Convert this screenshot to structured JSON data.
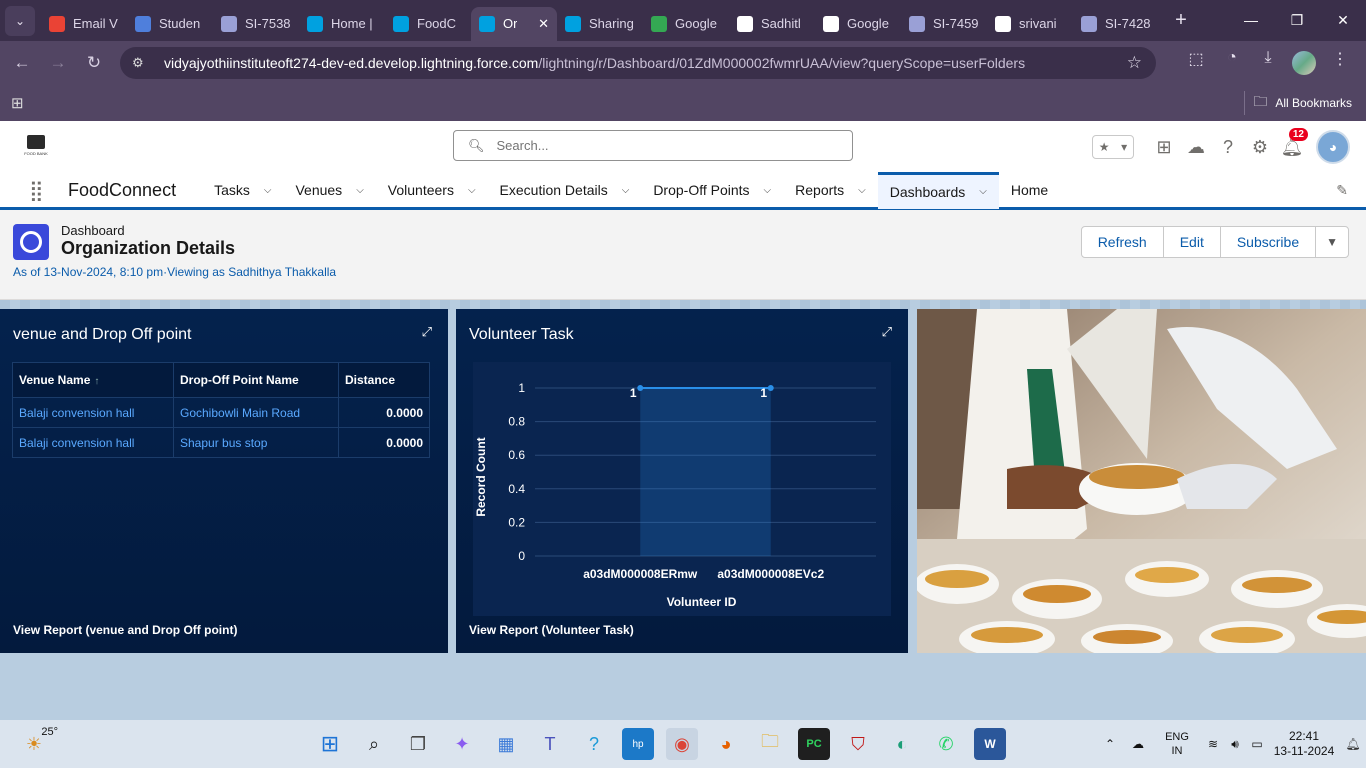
{
  "browser": {
    "tabs": [
      {
        "label": "Email V",
        "icon": "gmail-icon",
        "color": "#ea4335"
      },
      {
        "label": "Studen",
        "icon": "student-icon",
        "color": "#4f7fdc"
      },
      {
        "label": "SI-7538",
        "icon": "doc-icon",
        "color": "#9aa0d6"
      },
      {
        "label": "Home |",
        "icon": "salesforce-icon",
        "color": "#00a1e0"
      },
      {
        "label": "FoodC",
        "icon": "salesforce-icon",
        "color": "#00a1e0"
      },
      {
        "label": "Or",
        "icon": "salesforce-icon",
        "color": "#00a1e0",
        "active": true
      },
      {
        "label": "Sharing",
        "icon": "salesforce-icon",
        "color": "#00a1e0"
      },
      {
        "label": "Google",
        "icon": "google-drive-icon",
        "color": "#34a853"
      },
      {
        "label": "Sadhitl",
        "icon": "github-icon",
        "color": "#ffffff"
      },
      {
        "label": "Google",
        "icon": "google-icon",
        "color": "#ffffff"
      },
      {
        "label": "SI-7459",
        "icon": "doc-icon",
        "color": "#9aa0d6"
      },
      {
        "label": "srivani",
        "icon": "github-icon",
        "color": "#ffffff"
      },
      {
        "label": "SI-7428",
        "icon": "doc-icon",
        "color": "#9aa0d6"
      }
    ],
    "url_host": "vidyajyothiinstituteoft274-dev-ed.develop.lightning.force.com",
    "url_path": "/lightning/r/Dashboard/01ZdM000002fwmrUAA/view?queryScope=userFolders",
    "all_bookmarks": "All Bookmarks"
  },
  "sf": {
    "logo_text": "FOOD BANK",
    "search_placeholder": "Search...",
    "notification_count": "12",
    "app_name": "FoodConnect",
    "nav": [
      {
        "label": "Tasks",
        "chevron": true
      },
      {
        "label": "Venues",
        "chevron": true
      },
      {
        "label": "Volunteers",
        "chevron": true
      },
      {
        "label": "Execution Details",
        "chevron": true
      },
      {
        "label": "Drop-Off Points",
        "chevron": true
      },
      {
        "label": "Reports",
        "chevron": true
      },
      {
        "label": "Dashboards",
        "chevron": true,
        "active": true
      },
      {
        "label": "Home",
        "chevron": false
      }
    ]
  },
  "dashboard": {
    "kind": "Dashboard",
    "title": "Organization Details",
    "meta": "As of 13-Nov-2024, 8:10 pm·Viewing as Sadhithya Thakkalla",
    "buttons": {
      "refresh": "Refresh",
      "edit": "Edit",
      "subscribe": "Subscribe"
    }
  },
  "panel1": {
    "title": "venue and Drop Off point",
    "columns": [
      "Venue Name",
      "Drop-Off Point Name",
      "Distance"
    ],
    "rows": [
      [
        "Balaji convension hall",
        "Gochibowli Main Road",
        "0.0000"
      ],
      [
        "Balaji convension hall",
        "Shapur bus stop",
        "0.0000"
      ]
    ],
    "view_report": "View Report (venue and Drop Off point)"
  },
  "panel2": {
    "title": "Volunteer Task",
    "view_report": "View Report (Volunteer Task)"
  },
  "chart_data": {
    "type": "area",
    "categories": [
      "a03dM000008ERmw",
      "a03dM000008EVc2"
    ],
    "values": [
      1,
      1
    ],
    "data_labels": [
      "1",
      "1"
    ],
    "xlabel": "Volunteer ID",
    "ylabel": "Record Count",
    "ylim": [
      0,
      1
    ],
    "yticks": [
      "0",
      "0.2",
      "0.4",
      "0.6",
      "0.8",
      "1"
    ],
    "grid": true,
    "color": "#2a8fe8"
  },
  "taskbar": {
    "temperature": "25°",
    "lang1": "ENG",
    "lang2": "IN",
    "time": "22:41",
    "date": "13-11-2024"
  }
}
